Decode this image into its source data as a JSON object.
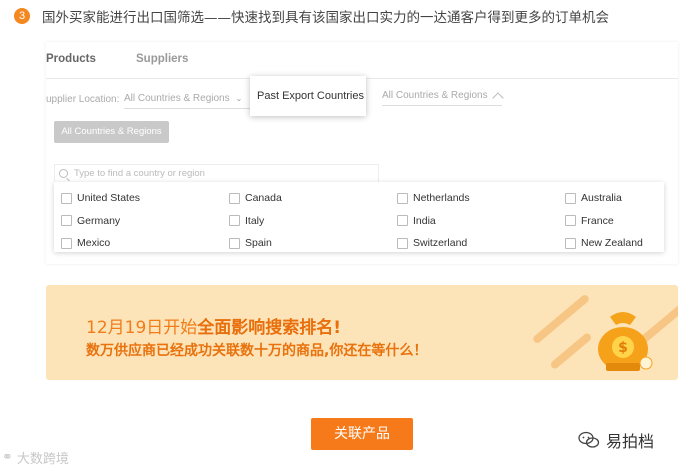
{
  "step": {
    "number": "3",
    "text": "国外买家能进行出口国筛选——快速找到具有该国家出口实力的一达通客户得到更多的订单机会"
  },
  "tabs": [
    {
      "label": "Products",
      "active": true
    },
    {
      "label": "Suppliers",
      "active": false
    }
  ],
  "filters": {
    "location_label": "upplier Location:",
    "location_value": "All Countries & Regions",
    "past_export_label": "Past Export Countries",
    "past_export_value": "All Countries & Regions",
    "all_button": "All Countries & Regions",
    "search_placeholder": "Type to find a country or region"
  },
  "countries": [
    "United States",
    "Canada",
    "Netherlands",
    "Australia",
    "Germany",
    "Italy",
    "India",
    "France",
    "Mexico",
    "Spain",
    "Switzerland",
    "New Zealand"
  ],
  "banner": {
    "line1_prefix": "12月19日开始",
    "line1_emphasis": "全面影响搜索排名!",
    "line2": "数万供应商已经成功关联数十万的商品,你还在等什么！",
    "coin_symbol": "$"
  },
  "action_button": "关联产品",
  "watermarks": {
    "left": "大数跨境",
    "right": "易拍档"
  },
  "colors": {
    "accent": "#f67a19",
    "banner_bg": "#fde4b8",
    "banner_text": "#f07d1a"
  }
}
